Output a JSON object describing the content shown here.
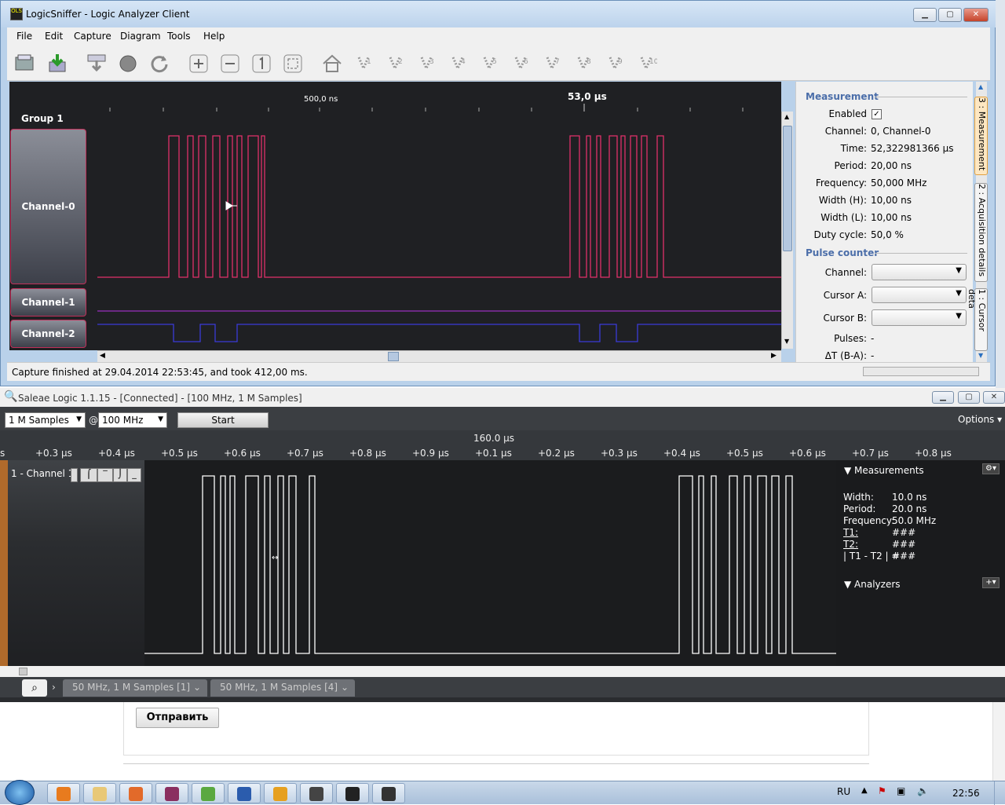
{
  "logicsniffer": {
    "title": "LogicSniffer - Logic Analyzer Client",
    "menu": [
      "File",
      "Edit",
      "Capture",
      "Diagram",
      "Tools",
      "Help"
    ],
    "group_label": "Group 1",
    "time_label_small": "500,0 ns",
    "time_label_cursor": "53,0 µs",
    "channels": [
      "Channel-0",
      "Channel-1",
      "Channel-2"
    ],
    "toolbar_icons": [
      "open-capture-icon",
      "save-capture-icon",
      "capture-icon",
      "stop-icon",
      "repeat-capture-icon",
      "zoom-in-icon",
      "zoom-out-icon",
      "zoom-default-icon",
      "zoom-all-icon",
      "goto-trigger-icon",
      "cursor-1-icon",
      "cursor-2-icon",
      "cursor-3-icon",
      "cursor-4-icon",
      "cursor-5-icon",
      "cursor-6-icon",
      "cursor-7-icon",
      "cursor-8-icon",
      "cursor-9-icon",
      "cursor-10-icon"
    ],
    "cursor_numbers": [
      "1",
      "2",
      "3",
      "4",
      "5",
      "6",
      "7",
      "8",
      "9",
      "10"
    ],
    "status": "Capture finished at 29.04.2014 22:53:45, and took 412,00 ms.",
    "measurement": {
      "heading": "Measurement",
      "rows": [
        {
          "k": "Enabled",
          "v": ""
        },
        {
          "k": "Channel:",
          "v": "0, Channel-0"
        },
        {
          "k": "Time:",
          "v": "52,322981366 µs"
        },
        {
          "k": "Period:",
          "v": "20,00 ns"
        },
        {
          "k": "Frequency:",
          "v": "50,000 MHz"
        },
        {
          "k": "Width (H):",
          "v": "10,00 ns"
        },
        {
          "k": "Width (L):",
          "v": "10,00 ns"
        },
        {
          "k": "Duty cycle:",
          "v": "50,0 %"
        }
      ],
      "pulse_heading": "Pulse counter",
      "pulse_rows": [
        {
          "k": "Channel:"
        },
        {
          "k": "Cursor A:"
        },
        {
          "k": "Cursor B:"
        }
      ],
      "pulses_label": "Pulses:",
      "pulses_value": "-",
      "dt_label": "ΔT (B-A):",
      "dt_value": "-"
    },
    "side_tabs": [
      "3 : Measurement",
      "2 : Acquisition details",
      "1 : Cursor deta"
    ]
  },
  "saleae": {
    "title": "Saleae Logic 1.1.15 - [Connected] - [100 MHz, 1 M Samples]",
    "samples": "1 M Samples",
    "at": "@",
    "rate": "100 MHz",
    "start": "Start",
    "options": "Options",
    "center_time": "160.0 µs",
    "ticks": [
      "s",
      "+0.3 µs",
      "+0.4 µs",
      "+0.5 µs",
      "+0.6 µs",
      "+0.7 µs",
      "+0.8 µs",
      "+0.9 µs",
      "+0.1 µs",
      "+0.2 µs",
      "+0.3 µs",
      "+0.4 µs",
      "+0.5 µs",
      "+0.6 µs",
      "+0.7 µs",
      "+0.8 µs"
    ],
    "channel": "1 - Channel 1",
    "measurements": {
      "heading": "Measurements",
      "rows": [
        {
          "k": "Width:",
          "v": "10.0 ns"
        },
        {
          "k": "Period:",
          "v": "20.0 ns"
        },
        {
          "k": "Frequency:",
          "v": "50.0 MHz"
        },
        {
          "k": "T1:",
          "v": "###"
        },
        {
          "k": "T2:",
          "v": "###"
        },
        {
          "k": "| T1 - T2 | =",
          "v": "###"
        }
      ]
    },
    "analyzers": "Analyzers",
    "tabs": [
      "50 MHz, 1 M Samples [1]",
      "50 MHz, 1 M Samples [4]"
    ]
  },
  "browser": {
    "submit": "Отправить"
  },
  "taskbar": {
    "lang": "RU",
    "time": "22:56",
    "apps": [
      "vlc-icon",
      "explorer-icon",
      "firefox-icon",
      "winrar-icon",
      "utorrent-icon",
      "word-icon",
      "info-icon",
      "saleae-icon",
      "cmd-icon",
      "ols-icon"
    ]
  },
  "colors": {
    "ch0": "#e0306a",
    "ch1": "#9b2fbf",
    "ch2": "#3b3bd8",
    "saleae_wave": "#ffffff",
    "link_blue": "#4b6ea9"
  }
}
